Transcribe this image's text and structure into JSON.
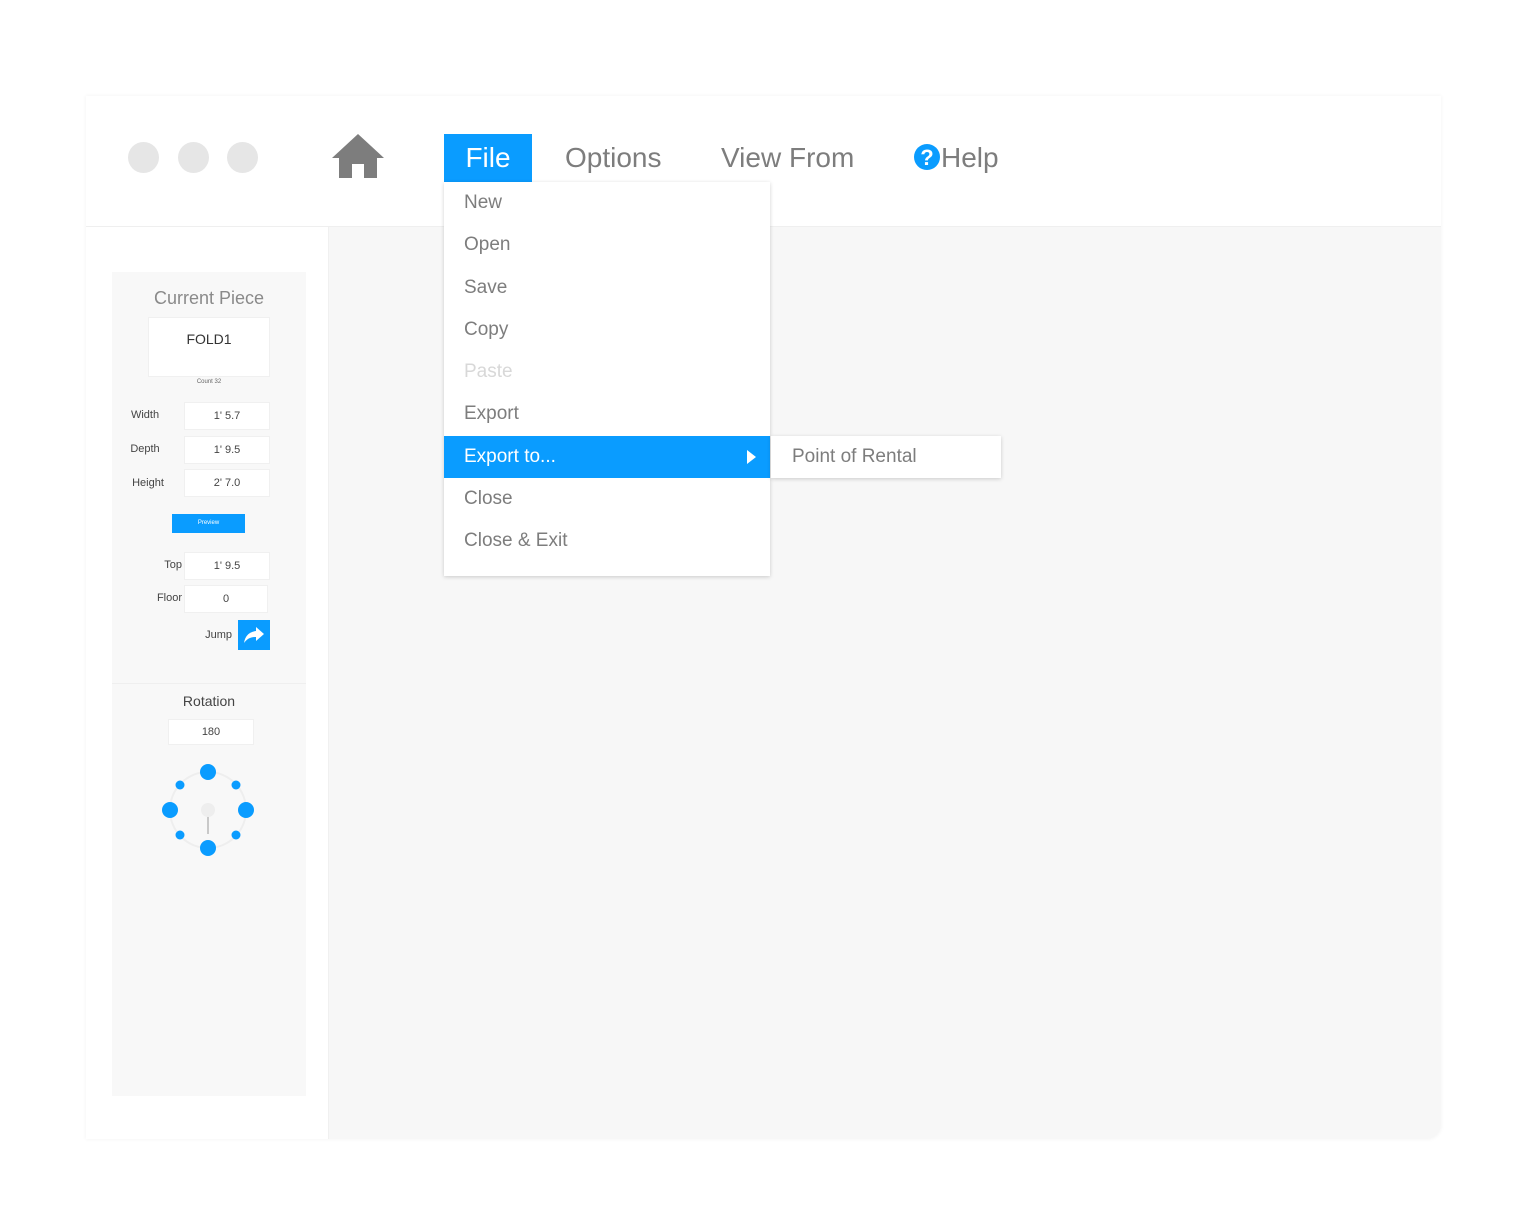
{
  "window_controls": [
    {
      "name": "close-dot",
      "color": "#e6e6e6"
    },
    {
      "name": "minimize-dot",
      "color": "#e6e6e6"
    },
    {
      "name": "maximize-dot",
      "color": "#e6e6e6"
    }
  ],
  "toolbar": {
    "home_icon": "home-icon",
    "menus": {
      "file": "File",
      "options": "Options",
      "view_from": "View From",
      "help": "Help"
    },
    "help_icon_glyph": "?"
  },
  "file_menu": {
    "items": [
      {
        "label": "New",
        "state": "enabled"
      },
      {
        "label": "Open",
        "state": "enabled"
      },
      {
        "label": "Save",
        "state": "enabled"
      },
      {
        "label": "Copy",
        "state": "enabled"
      },
      {
        "label": "Paste",
        "state": "disabled"
      },
      {
        "label": "Export",
        "state": "enabled"
      },
      {
        "label": "Export to...",
        "state": "highlighted",
        "has_submenu": true
      },
      {
        "label": "Close",
        "state": "enabled"
      },
      {
        "label": "Close & Exit",
        "state": "enabled"
      }
    ],
    "submenu": {
      "items": [
        {
          "label": "Point of Rental"
        }
      ]
    }
  },
  "side_panel": {
    "title": "Current Piece",
    "piece_name": "FOLD1",
    "count_label": "Count 32",
    "dimensions": {
      "width_label": "Width",
      "width_value": "1' 5.7",
      "depth_label": "Depth",
      "depth_value": "1' 9.5",
      "height_label": "Height",
      "height_value": "2' 7.0"
    },
    "preview_button": "Preview",
    "position": {
      "top_label": "Top",
      "top_value": "1' 9.5",
      "floor_label": "Floor",
      "floor_value": "0"
    },
    "jump_label": "Jump",
    "jump_icon": "share-arrow-icon",
    "rotation_title": "Rotation",
    "rotation_value": "180"
  },
  "colors": {
    "accent": "#0a9cff",
    "menu_text": "#7d7d7d",
    "disabled_text": "#d8d8d8",
    "canvas_bg": "#f7f7f7",
    "panel_bg": "#f8f8f8"
  }
}
